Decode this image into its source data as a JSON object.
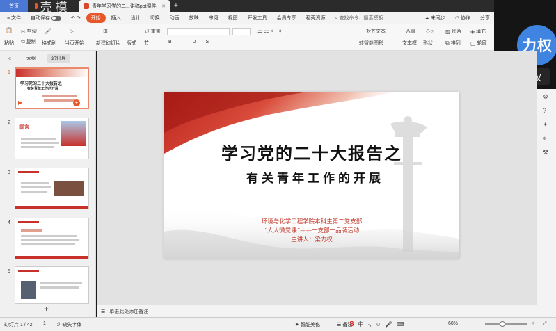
{
  "tabs": [
    {
      "label": "首页"
    },
    {
      "label": "找稻壳模板"
    },
    {
      "label": "青年学习党的二...讲稿ppt课件"
    }
  ],
  "menu": {
    "file": "文件",
    "autosave": "自动保存",
    "items": [
      "开始",
      "插入",
      "设计",
      "切换",
      "动画",
      "放映",
      "审阅",
      "视图",
      "开发工具",
      "会员专享",
      "稻壳资源"
    ],
    "search": "查找命令、搜索模板",
    "unsynced": "未同步",
    "collab": "协作",
    "share": "分享"
  },
  "ribbon": {
    "cut": "剪切",
    "copy": "复制",
    "paste": "粘贴",
    "format_painter": "格式刷",
    "play_current": "当页开始",
    "new_slide": "新建幻灯片",
    "layout": "版式",
    "section": "节",
    "reset": "重置",
    "align_text": "对齐文本",
    "convert_smartart": "转智能图形",
    "textbox": "文本框",
    "shape": "形状",
    "picture": "图片",
    "fill": "填充",
    "arrange": "排列",
    "outline": "轮廓"
  },
  "participant": {
    "avatar_text": "力权",
    "name": "梁力权"
  },
  "left_panel": {
    "tab_outline": "大纲",
    "tab_slides": "幻灯片",
    "slide_numbers": [
      "1",
      "2",
      "3",
      "4",
      "5"
    ],
    "thumb1_title": "学习党的二十大报告之",
    "thumb1_sub": "有关青年工作的开展",
    "thumb2_title": "前言"
  },
  "slide": {
    "title1": "学习党的二十大报告之",
    "title2": "有关青年工作的开展",
    "line1": "环境与化学工程学院本科生第二党支部",
    "line2": "“人人微党课”——一支部一品牌活动",
    "line3": "主讲人：梁力权"
  },
  "notes": {
    "placeholder": "单击此处添加备注"
  },
  "status": {
    "slide_count": "幻灯片 1 / 42",
    "page": "1",
    "missing_font": "缺失字体",
    "beautify": "智能美化",
    "notes_label": "备注",
    "zoom": "60%"
  },
  "colors": {
    "accent": "#e8572a",
    "home_tab": "#4a78d4",
    "avatar": "#3f84e0",
    "slide_red": "#c8302a"
  }
}
